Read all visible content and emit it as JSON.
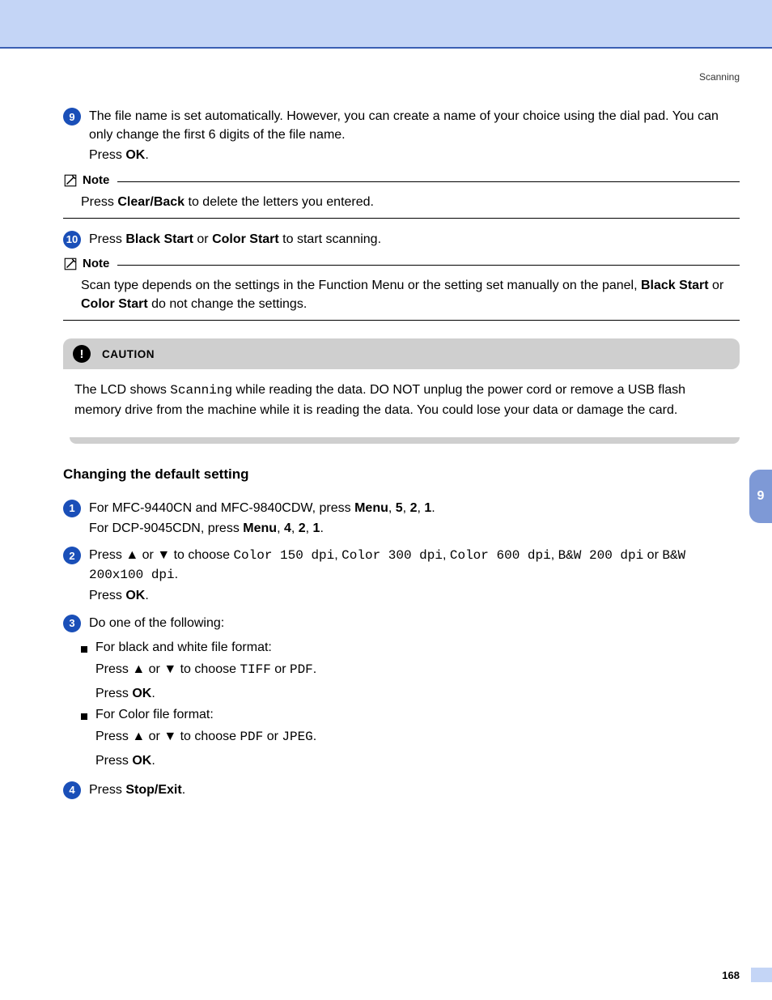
{
  "header": {
    "section": "Scanning"
  },
  "sideTab": {
    "chapter": "9"
  },
  "footer": {
    "pageNumber": "168"
  },
  "steps": {
    "s9": {
      "num": "9",
      "line1": "The file name is set automatically. However, you can create a name of your choice using the dial pad. You can only change the first 6 digits of the file name.",
      "line2a": "Press ",
      "line2b": "OK",
      "line2c": "."
    },
    "s10": {
      "num": "10",
      "a": "Press ",
      "b": "Black Start",
      "c": " or ",
      "d": "Color Start",
      "e": " to start scanning."
    }
  },
  "notes": {
    "title": "Note",
    "n1": {
      "a": "Press ",
      "b": "Clear/Back",
      "c": " to delete the letters you entered."
    },
    "n2": {
      "a": "Scan type depends on the settings in the Function Menu or the setting set manually on the panel, ",
      "b": "Black Start",
      "c": " or ",
      "d": "Color Start",
      "e": " do not change the settings."
    }
  },
  "caution": {
    "title": "CAUTION",
    "a": "The LCD shows ",
    "b": "Scanning",
    "c": " while reading the data. DO NOT unplug the power cord or remove a USB flash memory drive from the machine while it is reading the data. You could lose your data or damage the card."
  },
  "section2": {
    "title": "Changing the default setting",
    "s1": {
      "num": "1",
      "a": "For MFC-9440CN and MFC-9840CDW, press ",
      "b1": "Menu",
      "c1": ", ",
      "b2": "5",
      "c2": ", ",
      "b3": "2",
      "c3": ", ",
      "b4": "1",
      "c4": ".",
      "d": "For DCP-9045CDN, press ",
      "e1": "Menu",
      "f1": ", ",
      "e2": "4",
      "f2": ", ",
      "e3": "2",
      "f3": ", ",
      "e4": "1",
      "f4": "."
    },
    "s2": {
      "num": "2",
      "a": "Press ",
      "up": "▲",
      "b": " or ",
      "down": "▼",
      "c": " to choose ",
      "opt1": "Color 150 dpi",
      "sep1": ", ",
      "opt2": "Color 300 dpi",
      "sep2": ", ",
      "opt3": "Color 600 dpi",
      "sep3": ", ",
      "opt4": "B&W 200 dpi",
      "sep4": " or ",
      "opt5": "B&W 200x100 dpi",
      "end": ".",
      "p2a": "Press ",
      "p2b": "OK",
      "p2c": "."
    },
    "s3": {
      "num": "3",
      "intro": "Do one of the following:",
      "bw": {
        "head": "For black and white file format:",
        "a": "Press ",
        "up": "▲",
        "b": " or ",
        "down": "▼",
        "c": " to choose ",
        "o1": "TIFF",
        "d": " or ",
        "o2": "PDF",
        "e": ".",
        "p2a": "Press ",
        "p2b": "OK",
        "p2c": "."
      },
      "color": {
        "head": "For Color file format:",
        "a": "Press ",
        "up": "▲",
        "b": " or ",
        "down": "▼",
        "c": " to choose ",
        "o1": "PDF",
        "d": " or ",
        "o2": "JPEG",
        "e": ".",
        "p2a": "Press ",
        "p2b": "OK",
        "p2c": "."
      }
    },
    "s4": {
      "num": "4",
      "a": "Press ",
      "b": "Stop/Exit",
      "c": "."
    }
  }
}
